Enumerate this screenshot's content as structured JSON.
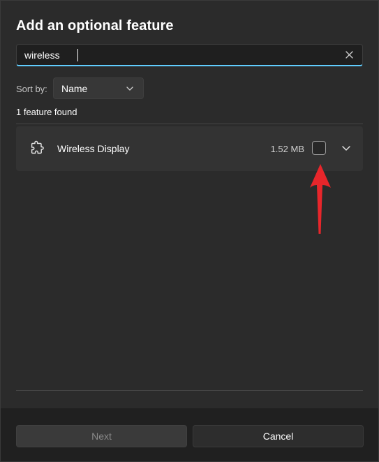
{
  "dialog": {
    "title": "Add an optional feature"
  },
  "search": {
    "value": "wireless",
    "clear_icon": "close-icon"
  },
  "sort": {
    "label": "Sort by:",
    "selected": "Name",
    "icon": "chevron-down-icon"
  },
  "results": {
    "count_text": "1 feature found",
    "items": [
      {
        "name": "Wireless Display",
        "size": "1.52 MB",
        "checked": false,
        "icon": "puzzle-piece-icon"
      }
    ]
  },
  "annotation": {
    "color": "#e8262b",
    "points_to": "feature-checkbox"
  },
  "footer": {
    "next_label": "Next",
    "cancel_label": "Cancel"
  },
  "colors": {
    "accent": "#60cdff",
    "dialog_bg": "#2b2b2b",
    "footer_bg": "#202020"
  }
}
